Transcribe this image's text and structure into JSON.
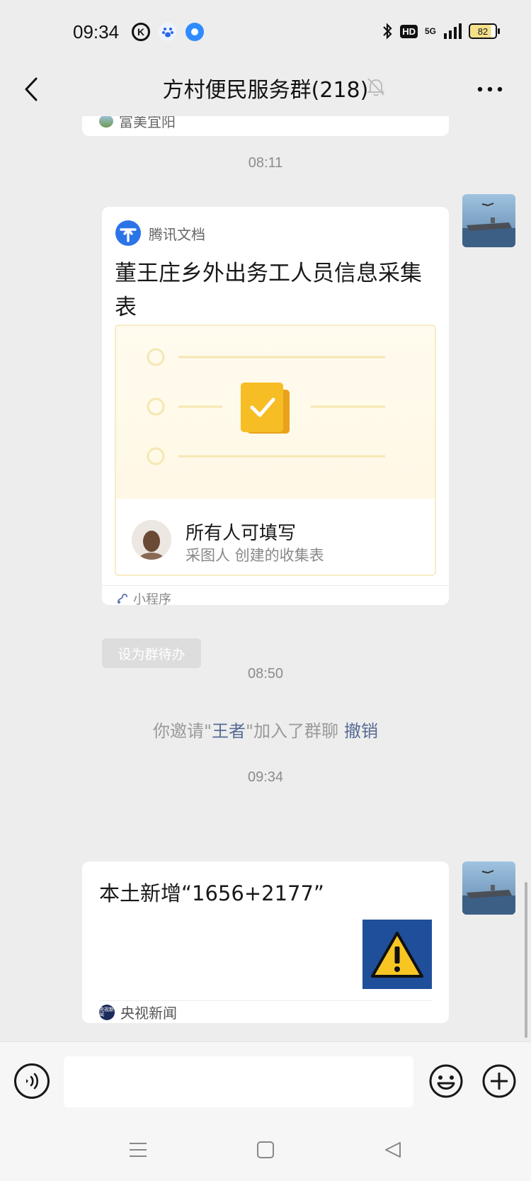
{
  "status_bar": {
    "time": "09:34",
    "network_label": "5G",
    "hd_label": "HD",
    "battery": "82"
  },
  "header": {
    "title": "方村便民服务群(218)"
  },
  "messages": {
    "previous_card_source": "富美宜阳",
    "time_1": "08:11",
    "doc_card": {
      "brand": "腾讯文档",
      "title": "董王庄乡外出务工人员信息采集表",
      "permission": "所有人可填写",
      "creator_line": "采图人 创建的收集表",
      "mini_program_label": "小程序"
    },
    "todo_button": "设为群待办",
    "time_2": "08:50",
    "system_message": {
      "prefix": "你邀请\"",
      "name": "王者",
      "suffix": "\"加入了群聊",
      "revoke": "撤销"
    },
    "time_3": "09:34",
    "news_card": {
      "title": "本土新增“1656+2177”",
      "source": "央视新闻",
      "source_icon_text": "央视新闻"
    }
  },
  "input": {
    "placeholder": ""
  },
  "colors": {
    "background": "#ededed",
    "link_blue": "#576b95",
    "doc_accent": "#f5b821",
    "tencent_blue": "#2b74e8"
  }
}
